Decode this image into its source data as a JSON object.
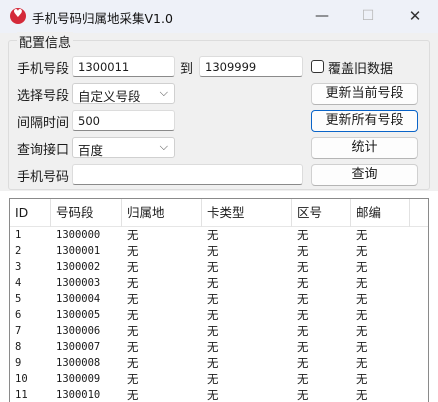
{
  "window": {
    "title": "手机号码归属地采集V1.0",
    "minimize": "—",
    "maximize": "☐",
    "close": "✕"
  },
  "config": {
    "group_title": "配置信息",
    "segment_label": "手机号段",
    "segment_from": "1300011",
    "to_label": "到",
    "segment_to": "1309999",
    "overwrite_label": "覆盖旧数据",
    "overwrite_checked": false,
    "select_label": "选择号段",
    "select_value": "自定义号段",
    "interval_label": "间隔时间",
    "interval_value": "500",
    "api_label": "查询接口",
    "api_value": "百度",
    "phone_label": "手机号码",
    "phone_value": "",
    "update_current_btn": "更新当前号段",
    "update_all_btn": "更新所有号段",
    "stats_btn": "统计",
    "query_btn": "查询"
  },
  "table": {
    "columns": [
      "ID",
      "号码段",
      "归属地",
      "卡类型",
      "区号",
      "邮编"
    ],
    "rows": [
      [
        "1",
        "1300000",
        "无",
        "无",
        "无",
        "无"
      ],
      [
        "2",
        "1300001",
        "无",
        "无",
        "无",
        "无"
      ],
      [
        "3",
        "1300002",
        "无",
        "无",
        "无",
        "无"
      ],
      [
        "4",
        "1300003",
        "无",
        "无",
        "无",
        "无"
      ],
      [
        "5",
        "1300004",
        "无",
        "无",
        "无",
        "无"
      ],
      [
        "6",
        "1300005",
        "无",
        "无",
        "无",
        "无"
      ],
      [
        "7",
        "1300006",
        "无",
        "无",
        "无",
        "无"
      ],
      [
        "8",
        "1300007",
        "无",
        "无",
        "无",
        "无"
      ],
      [
        "9",
        "1300008",
        "无",
        "无",
        "无",
        "无"
      ],
      [
        "10",
        "1300009",
        "无",
        "无",
        "无",
        "无"
      ],
      [
        "11",
        "1300010",
        "无",
        "无",
        "无",
        "无"
      ]
    ]
  }
}
